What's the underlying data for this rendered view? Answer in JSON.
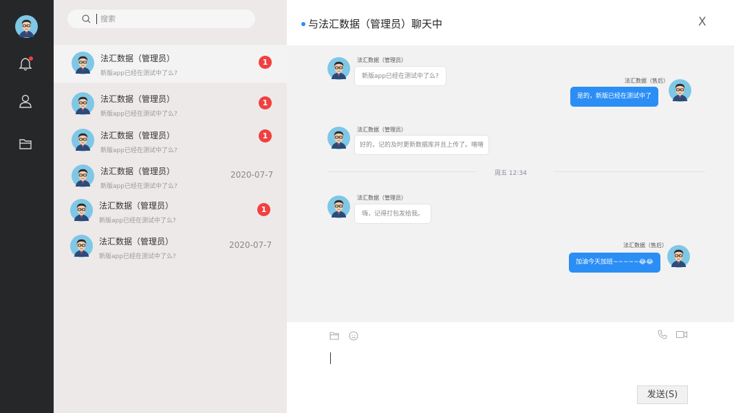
{
  "nav": {
    "icons": [
      "avatar",
      "bell-icon",
      "user-icon",
      "folder-icon"
    ],
    "notification_color": "#f33d3d"
  },
  "search": {
    "placeholder": "搜索"
  },
  "conversations": [
    {
      "name": "法汇数据（管理员）",
      "preview": "新版app已经在测试中了么?",
      "badge": "1",
      "date": "",
      "active": true
    },
    {
      "name": "法汇数据（管理员）",
      "preview": "新版app已经在测试中了么?",
      "badge": "1",
      "date": ""
    },
    {
      "name": "法汇数据（管理员）",
      "preview": "新版app已经在测试中了么?",
      "badge": "1",
      "date": ""
    },
    {
      "name": "法汇数据（管理员）",
      "preview": "新版app已经在测试中了么?",
      "badge": "",
      "date": "2020-07-7"
    },
    {
      "name": "法汇数据（管理员）",
      "preview": "新版app已经在测试中了么?",
      "badge": "1",
      "date": ""
    },
    {
      "name": "法汇数据（管理员）",
      "preview": "新版app已经在测试中了么?",
      "badge": "",
      "date": "2020-07-7"
    }
  ],
  "chat": {
    "title": "与法汇数据（管理员）聊天中",
    "close_label": "X",
    "messages": [
      {
        "sender": "法汇数据（管理员）",
        "text": "新版app已经在测试中了么?",
        "direction": "in"
      },
      {
        "sender": "法汇数据（售后）",
        "text": "是的，新版已经在测试中了",
        "direction": "out"
      },
      {
        "sender": "法汇数据（管理员）",
        "text": "好的，记的及时更新数据库并且上传了。嘻嘻",
        "direction": "in"
      },
      {
        "sender": "法汇数据（管理员）",
        "text": "嗨，记得打包发给我。",
        "direction": "in"
      },
      {
        "sender": "法汇数据（售后）",
        "text": "加油今天加班~~~~~",
        "direction": "out",
        "emoji": "😂😂"
      }
    ],
    "separator": "周五  12:34",
    "send_label": "发送(S)",
    "accent": "#2b8ef5"
  }
}
